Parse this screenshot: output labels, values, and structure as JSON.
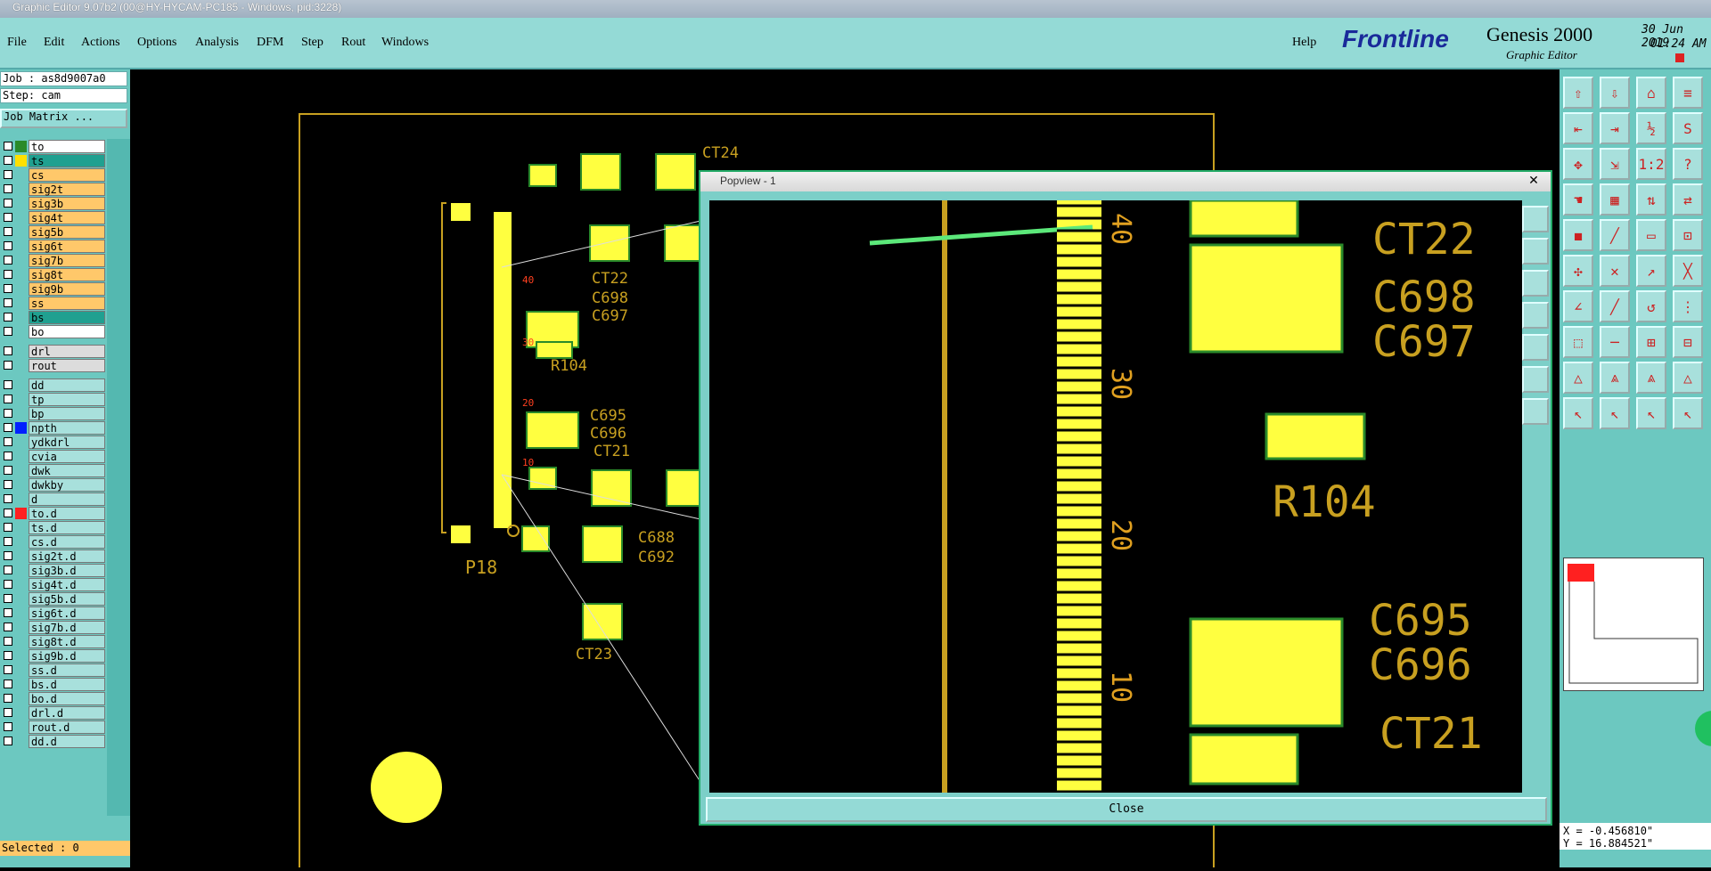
{
  "window": {
    "title": "Graphic Editor 9.07b2 (00@HY-HYCAM-PC185 - Windows, pid:3228)"
  },
  "menu": {
    "items": [
      "File",
      "Edit",
      "Actions",
      "Options",
      "Analysis",
      "DFM",
      "Step",
      "Rout",
      "Windows"
    ],
    "help": "Help"
  },
  "brand": {
    "logo": "Frontline",
    "product": "Genesis 2000",
    "subtitle": "Graphic Editor",
    "date": "30 Jun 2019",
    "time": "01:24 AM"
  },
  "job": {
    "job_label": "Job : as8d9007a0",
    "step_label": "Step: cam",
    "matrix_button": "Job Matrix ..."
  },
  "layers": [
    {
      "name": "to",
      "swatch": "#2a8a2a",
      "bg": "#ffffff"
    },
    {
      "name": "ts",
      "swatch": "#ffe000",
      "bg": "#20a090"
    },
    {
      "name": "cs",
      "swatch": "",
      "bg": "#ffc86a"
    },
    {
      "name": "sig2t",
      "swatch": "",
      "bg": "#ffc86a"
    },
    {
      "name": "sig3b",
      "swatch": "",
      "bg": "#ffc86a"
    },
    {
      "name": "sig4t",
      "swatch": "",
      "bg": "#ffc86a"
    },
    {
      "name": "sig5b",
      "swatch": "",
      "bg": "#ffc86a"
    },
    {
      "name": "sig6t",
      "swatch": "",
      "bg": "#ffc86a"
    },
    {
      "name": "sig7b",
      "swatch": "",
      "bg": "#ffc86a"
    },
    {
      "name": "sig8t",
      "swatch": "",
      "bg": "#ffc86a"
    },
    {
      "name": "sig9b",
      "swatch": "",
      "bg": "#ffc86a"
    },
    {
      "name": "ss",
      "swatch": "",
      "bg": "#ffc86a"
    },
    {
      "name": "bs",
      "swatch": "",
      "bg": "#20a090"
    },
    {
      "name": "bo",
      "swatch": "",
      "bg": "#ffffff"
    },
    {
      "name": "drl",
      "swatch": "",
      "bg": "#dcdcdc"
    },
    {
      "name": "rout",
      "swatch": "",
      "bg": "#dcdcdc"
    },
    {
      "name": "dd",
      "swatch": "",
      "bg": "#a8e0dc"
    },
    {
      "name": "tp",
      "swatch": "",
      "bg": "#a8e0dc"
    },
    {
      "name": "bp",
      "swatch": "",
      "bg": "#a8e0dc"
    },
    {
      "name": "npth",
      "swatch": "#0020ff",
      "bg": "#a8e0dc"
    },
    {
      "name": "ydkdrl",
      "swatch": "",
      "bg": "#a8e0dc"
    },
    {
      "name": "cvia",
      "swatch": "",
      "bg": "#a8e0dc"
    },
    {
      "name": "dwk",
      "swatch": "",
      "bg": "#a8e0dc"
    },
    {
      "name": "dwkby",
      "swatch": "",
      "bg": "#a8e0dc"
    },
    {
      "name": "d",
      "swatch": "",
      "bg": "#a8e0dc"
    },
    {
      "name": "to.d",
      "swatch": "#ff2020",
      "bg": "#a8e0dc"
    },
    {
      "name": "ts.d",
      "swatch": "",
      "bg": "#a8e0dc"
    },
    {
      "name": "cs.d",
      "swatch": "",
      "bg": "#a8e0dc"
    },
    {
      "name": "sig2t.d",
      "swatch": "",
      "bg": "#a8e0dc"
    },
    {
      "name": "sig3b.d",
      "swatch": "",
      "bg": "#a8e0dc"
    },
    {
      "name": "sig4t.d",
      "swatch": "",
      "bg": "#a8e0dc"
    },
    {
      "name": "sig5b.d",
      "swatch": "",
      "bg": "#a8e0dc"
    },
    {
      "name": "sig6t.d",
      "swatch": "",
      "bg": "#a8e0dc"
    },
    {
      "name": "sig7b.d",
      "swatch": "",
      "bg": "#a8e0dc"
    },
    {
      "name": "sig8t.d",
      "swatch": "",
      "bg": "#a8e0dc"
    },
    {
      "name": "sig9b.d",
      "swatch": "",
      "bg": "#a8e0dc"
    },
    {
      "name": "ss.d",
      "swatch": "",
      "bg": "#a8e0dc"
    },
    {
      "name": "bs.d",
      "swatch": "",
      "bg": "#a8e0dc"
    },
    {
      "name": "bo.d",
      "swatch": "",
      "bg": "#a8e0dc"
    },
    {
      "name": "drl.d",
      "swatch": "",
      "bg": "#a8e0dc"
    },
    {
      "name": "rout.d",
      "swatch": "",
      "bg": "#a8e0dc"
    },
    {
      "name": "dd.d",
      "swatch": "",
      "bg": "#a8e0dc"
    }
  ],
  "status": {
    "selected": "Selected : 0",
    "x": "X = -0.456810\"",
    "y": "Y = 16.884521\""
  },
  "board": {
    "labels": [
      "CT24",
      "CT22",
      "C698",
      "C697",
      "R104",
      "C695",
      "C696",
      "CT21",
      "C688",
      "C692",
      "P18",
      "CT23"
    ],
    "pin_labels": [
      "30",
      "40",
      "20",
      "10"
    ]
  },
  "popview": {
    "title": "Popview - 1",
    "close_label": "Close",
    "labels": [
      "CT22",
      "C698",
      "C697",
      "R104",
      "C695",
      "C696",
      "CT21"
    ],
    "pin_labels": [
      "40",
      "30",
      "20",
      "10"
    ]
  },
  "colors": {
    "pcb_yellow": "#ffff40",
    "silk": "#c8a020",
    "panel_teal": "#6cc8c0",
    "menu_teal": "#94dad6"
  }
}
